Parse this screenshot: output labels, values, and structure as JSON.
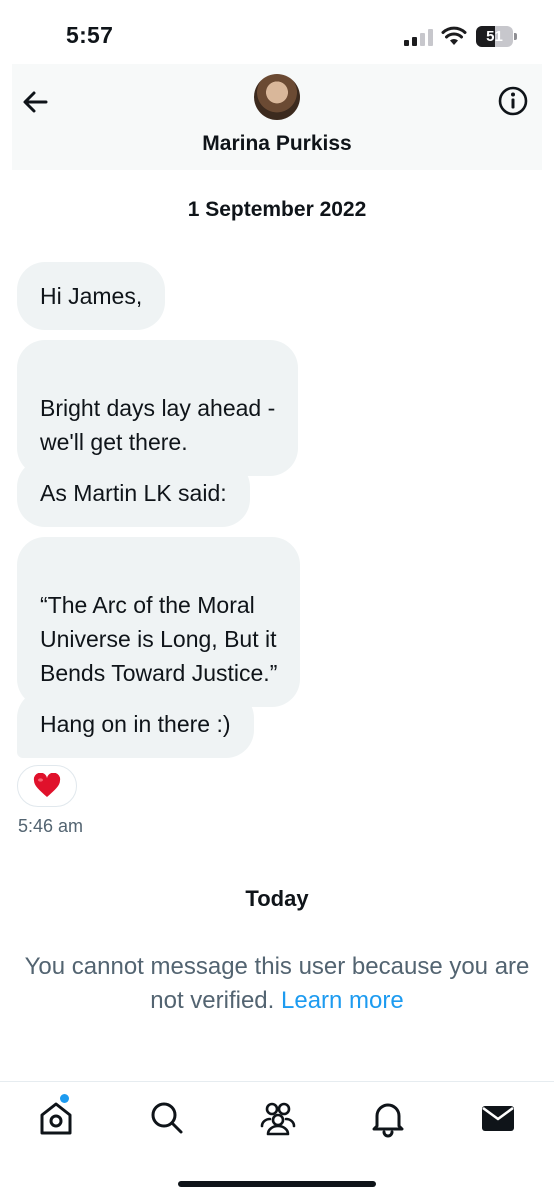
{
  "status_bar": {
    "time": "5:57",
    "battery_level": "51",
    "battery_percent": 51
  },
  "header": {
    "back_icon": "arrow-left-icon",
    "contact_name": "Marina Purkiss",
    "info_icon": "info-circle-icon"
  },
  "conversation": {
    "date_label": "1 September 2022",
    "messages": [
      {
        "text": "Hi James,"
      },
      {
        "text": "Bright days lay ahead -\nwe'll get there."
      },
      {
        "text": "As Martin LK said:"
      },
      {
        "text": "“The Arc of the Moral\nUniverse is Long, But it\nBends Toward Justice.”"
      },
      {
        "text": "Hang on in there :)"
      }
    ],
    "reaction": "❤️",
    "timestamp": "5:46 am",
    "today_label": "Today",
    "notice_text": "You cannot message this user because you are not verified.",
    "learn_more_label": "Learn more"
  },
  "bottom_nav": {
    "items": [
      "home-icon",
      "search-icon",
      "communities-icon",
      "notifications-icon",
      "messages-icon"
    ],
    "accent_color": "#1d9bf0"
  }
}
